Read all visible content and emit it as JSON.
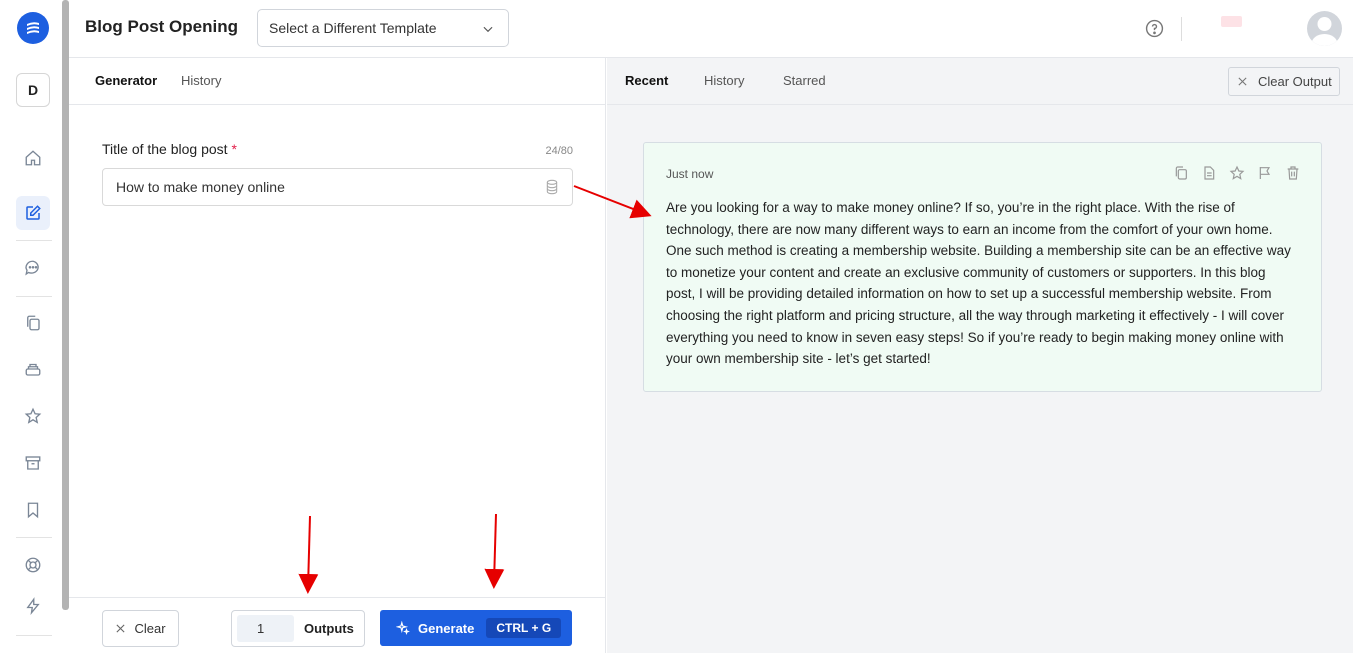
{
  "header": {
    "title": "Blog Post Opening",
    "template_select": "Select a Different Template"
  },
  "sidebar": {
    "workspace_initial": "D",
    "items": [
      {
        "icon": "home-icon"
      },
      {
        "icon": "edit-icon",
        "active": true
      },
      {
        "icon": "chat-icon"
      },
      {
        "icon": "copy-icon"
      },
      {
        "icon": "layers-icon"
      },
      {
        "icon": "star-icon"
      },
      {
        "icon": "archive-icon"
      },
      {
        "icon": "bookmark-icon"
      },
      {
        "icon": "lifebuoy-icon"
      },
      {
        "icon": "bolt-icon"
      }
    ]
  },
  "left_panel": {
    "tabs": [
      "Generator",
      "History"
    ],
    "field": {
      "label": "Title of the blog post",
      "required_mark": "*",
      "char_count": "24/80",
      "value": "How to make money online"
    },
    "footer": {
      "clear_label": "Clear",
      "outputs_value": "1",
      "outputs_label": "Outputs",
      "generate_label": "Generate",
      "shortcut": "CTRL + G"
    }
  },
  "right_panel": {
    "tabs": [
      "Recent",
      "History",
      "Starred"
    ],
    "clear_output_label": "Clear Output",
    "card": {
      "time": "Just now",
      "text": "Are you looking for a way to make money online? If so, you’re in the right place. With the rise of technology, there are now many different ways to earn an income from the comfort of your own home. One such method is creating a membership website. Building a membership site can be an effective way to monetize your content and create an exclusive community of customers or supporters. In this blog post, I will be providing detailed information on how to set up a successful membership website. From choosing the right platform and pricing structure, all the way through marketing it effectively - I will cover everything you need to know in seven easy steps! So if you’re ready to begin making money online with your own membership site - let’s get started!"
    }
  },
  "colors": {
    "brand": "#1d5fe0",
    "arrow": "#e60000",
    "card_bg": "#f0fbf4"
  }
}
